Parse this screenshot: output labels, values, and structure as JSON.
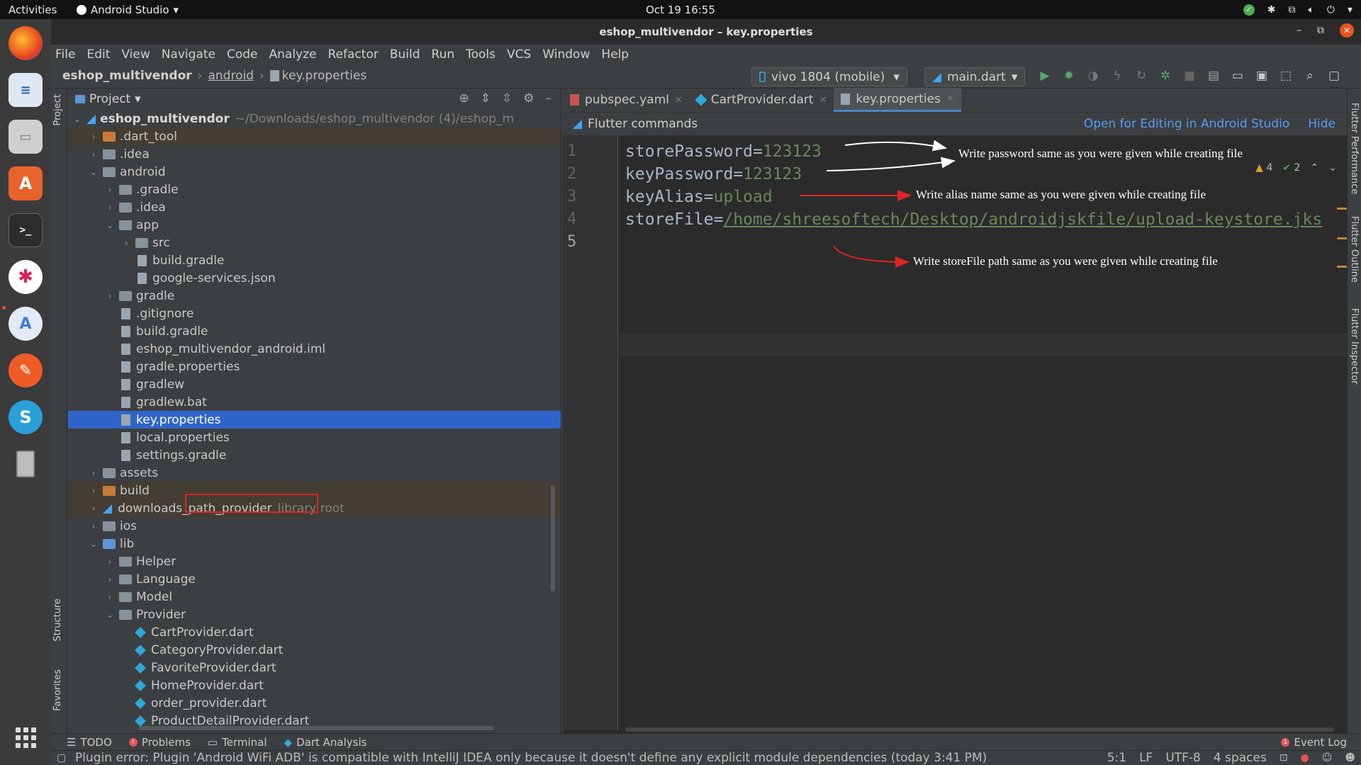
{
  "os_topbar": {
    "activities": "Activities",
    "app_name": "Android Studio",
    "datetime": "Oct 19  16:55"
  },
  "window": {
    "title": "eshop_multivendor – key.properties"
  },
  "menu": [
    "File",
    "Edit",
    "View",
    "Navigate",
    "Code",
    "Analyze",
    "Refactor",
    "Build",
    "Run",
    "Tools",
    "VCS",
    "Window",
    "Help"
  ],
  "breadcrumb": {
    "project": "eshop_multivendor",
    "folder": "android",
    "file": "key.properties"
  },
  "toolbar": {
    "device": "vivo 1804 (mobile)",
    "run_config": "main.dart"
  },
  "project_panel": {
    "title": "Project",
    "root_name": "eshop_multivendor",
    "root_path": "~/Downloads/eshop_multivendor (4)/eshop_m",
    "items": [
      {
        "label": ".dart_tool"
      },
      {
        "label": ".idea"
      },
      {
        "label": "android"
      },
      {
        "label": ".gradle"
      },
      {
        "label": ".idea"
      },
      {
        "label": "app"
      },
      {
        "label": "src"
      },
      {
        "label": "build.gradle"
      },
      {
        "label": "google-services.json"
      },
      {
        "label": "gradle"
      },
      {
        "label": ".gitignore"
      },
      {
        "label": "build.gradle"
      },
      {
        "label": "eshop_multivendor_android.iml"
      },
      {
        "label": "gradle.properties"
      },
      {
        "label": "gradlew"
      },
      {
        "label": "gradlew.bat"
      },
      {
        "label": "key.properties"
      },
      {
        "label": "local.properties"
      },
      {
        "label": "settings.gradle"
      },
      {
        "label": "assets"
      },
      {
        "label": "build"
      },
      {
        "label": "downloads_path_provider",
        "note": "library root"
      },
      {
        "label": "ios"
      },
      {
        "label": "lib"
      },
      {
        "label": "Helper"
      },
      {
        "label": "Language"
      },
      {
        "label": "Model"
      },
      {
        "label": "Provider"
      },
      {
        "label": "CartProvider.dart"
      },
      {
        "label": "CategoryProvider.dart"
      },
      {
        "label": "FavoriteProvider.dart"
      },
      {
        "label": "HomeProvider.dart"
      },
      {
        "label": "order_provider.dart"
      },
      {
        "label": "ProductDetailProvider.dart"
      }
    ]
  },
  "editor": {
    "tabs": [
      "pubspec.yaml",
      "CartProvider.dart",
      "key.properties"
    ],
    "flutter_bar": {
      "label": "Flutter commands",
      "open_link": "Open for Editing in Android Studio",
      "hide_link": "Hide"
    },
    "line_numbers": [
      "1",
      "2",
      "3",
      "4",
      "5"
    ],
    "lines": [
      {
        "key": "storePassword=",
        "value": "123123"
      },
      {
        "key": "keyPassword=",
        "value": "123123"
      },
      {
        "key": "keyAlias=",
        "value": "upload"
      },
      {
        "key": "storeFile=",
        "value": "/home/shreesoftech/Desktop/androidjskfile/upload-keystore.jks"
      }
    ],
    "inspection": {
      "warnings": "4",
      "weak_warnings": "2"
    },
    "annotations": {
      "password": "Write password  same as you were given while  creating file",
      "alias": "Write alias name same as you were given while  creating file",
      "storefile": "Write storeFile path same as you were given while  creating file"
    }
  },
  "side_tabs": {
    "left": [
      "Project",
      "Structure",
      "Favorites"
    ],
    "right": [
      "Flutter Performance",
      "Flutter Outline",
      "Flutter Inspector"
    ]
  },
  "bottom_tools": {
    "todo": "TODO",
    "problems": "Problems",
    "terminal": "Terminal",
    "dart_analysis": "Dart Analysis",
    "event_log": "Event Log"
  },
  "status": {
    "message": "Plugin error: Plugin 'Android WiFi ADB' is compatible with IntelliJ IDEA only because it doesn't define any explicit module dependencies (today 3:41 PM)",
    "position": "5:1",
    "line_sep": "LF",
    "encoding": "UTF-8",
    "indent": "4 spaces"
  },
  "colors": {
    "selection": "#2f65ca",
    "accent_link": "#589df6",
    "string_value": "#6a8759",
    "annotation_box": "#e02424"
  }
}
